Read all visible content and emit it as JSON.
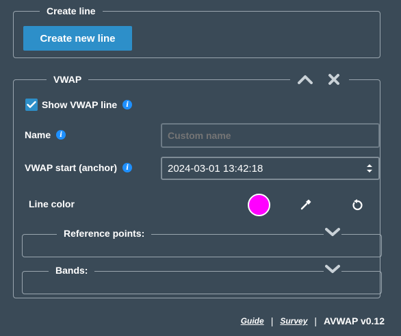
{
  "create_group": {
    "legend": "Create line",
    "button_label": "Create new line"
  },
  "vwap_group": {
    "legend": "VWAP",
    "collapse_icon": "chevron-up-icon",
    "close_icon": "close-icon",
    "show_line": {
      "label": "Show VWAP line",
      "checked": true
    },
    "name": {
      "label": "Name",
      "placeholder": "Custom name",
      "value": ""
    },
    "anchor": {
      "label": "VWAP start (anchor)",
      "value": "2024-03-01 13:42:18"
    },
    "line_color": {
      "label": "Line color",
      "color": "#ff00ff"
    },
    "reference_points": {
      "legend": "Reference points:"
    },
    "bands": {
      "legend": "Bands:"
    }
  },
  "footer": {
    "guide": "Guide",
    "separator": "|",
    "survey": "Survey",
    "version": "AVWAP v0.12"
  },
  "colors": {
    "background": "#3a4a57",
    "accent": "#2d8fc9",
    "info": "#1e90ff",
    "border": "#9aa6af"
  }
}
